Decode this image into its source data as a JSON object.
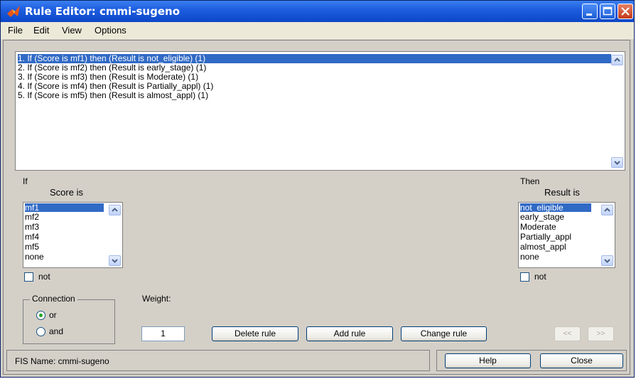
{
  "window": {
    "title": "Rule Editor: cmmi-sugeno"
  },
  "menu": [
    "File",
    "Edit",
    "View",
    "Options"
  ],
  "rules": [
    "1. If (Score is mf1) then (Result is not_eligible) (1)",
    "2. If (Score is mf2) then (Result is early_stage) (1)",
    "3. If (Score is mf3) then (Result is Moderate) (1)",
    "4. If (Score is mf4) then (Result is Partially_appl) (1)",
    "5. If (Score is mf5) then (Result is almost_appl) (1)"
  ],
  "selected_rule_index": 0,
  "if_section": {
    "label": "If",
    "input_label": "Score is",
    "items": [
      "mf1",
      "mf2",
      "mf3",
      "mf4",
      "mf5",
      "none"
    ],
    "selected_index": 0,
    "not_label": "not",
    "not_checked": false
  },
  "then_section": {
    "label": "Then",
    "output_label": "Result is",
    "items": [
      "not_eligible",
      "early_stage",
      "Moderate",
      "Partially_appl",
      "almost_appl",
      "none"
    ],
    "selected_index": 0,
    "not_label": "not",
    "not_checked": false
  },
  "connection": {
    "title": "Connection",
    "options": [
      "or",
      "and"
    ],
    "selected": "or"
  },
  "weight": {
    "label": "Weight:",
    "value": "1"
  },
  "buttons": {
    "delete_rule": "Delete rule",
    "add_rule": "Add rule",
    "change_rule": "Change rule",
    "prev": "<<",
    "next": ">>",
    "help": "Help",
    "close": "Close"
  },
  "status": {
    "text": "FIS Name: cmmi-sugeno"
  },
  "colors": {
    "titlebar": "#0b47c8",
    "selection": "#316ac5",
    "dialog_bg": "#d4d0c8",
    "radio_dot": "#21a121"
  }
}
